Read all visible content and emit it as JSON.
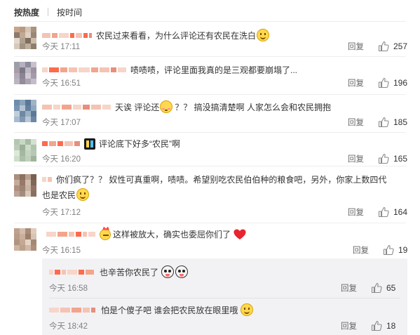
{
  "sort_tabs": {
    "hot": "按热度",
    "time": "按时间"
  },
  "reply_label": "回复",
  "colors": {
    "mosaic": [
      "#f2a58c",
      "#f5c3b3",
      "#ff6a4d",
      "#f7d5c9",
      "#e88e7a"
    ],
    "like_icon": "#8a8a8a"
  },
  "comments": [
    {
      "text": "农民过来看看，为什么评论还有农民在洗白",
      "emoji": "smile",
      "time": "今天 17:11",
      "likes": "257",
      "avatar": [
        "#c9a48a",
        "#b89a80",
        "#d8c4b2",
        "#a9927e",
        "#8d7a6a",
        "#c0a894",
        "#ddd0c4",
        "#9a8676",
        "#e4d8cc",
        "#b0a090",
        "#7f6e60",
        "#cdbcaa",
        "#d6c9bb",
        "#a39282",
        "#bfae9c",
        "#8e7d6d"
      ]
    },
    {
      "text": "啧啧啧，评论里面我真的是三观都要崩塌了...",
      "time": "今天 16:51",
      "likes": "196",
      "avatar": [
        "#9aa0a8",
        "#b6b0c0",
        "#8c8c9c",
        "#c8c0cc",
        "#a89ca8",
        "#7c7888",
        "#c0b8c4",
        "#9c94a0",
        "#b4acb8",
        "#8c8494",
        "#d0c8d4",
        "#a49cac",
        "#bcb4c0",
        "#948c98",
        "#aca4b0",
        "#c4bcc8"
      ]
    },
    {
      "text1": "天诶 评论还",
      "emoji": "shy",
      "text2": "？？ 搞没搞清楚啊 人家怎么会和农民拥抱",
      "time": "今天 17:07",
      "likes": "185",
      "avatar": [
        "#6c8caa",
        "#8aa4bc",
        "#5a7896",
        "#a0b4c8",
        "#7894ae",
        "#b4c4d4",
        "#6480a0",
        "#90a8bf",
        "#c0cedc",
        "#7088a4",
        "#9cb0c4",
        "#5c7898",
        "#a8bcd0",
        "#8098b2",
        "#b8c8d8",
        "#6c86a6"
      ]
    },
    {
      "emoji": "book",
      "text": "评论底下好多“农民”啊",
      "time": "今天 16:20",
      "likes": "165",
      "avatar": [
        "#b4c8b0",
        "#c8d8c4",
        "#a8bca4",
        "#d4e0d0",
        "#bcccb8",
        "#9cb098",
        "#ccdcc8",
        "#b0c4ac",
        "#dce8d8",
        "#a4b8a0",
        "#c4d4c0",
        "#b8c8b4",
        "#d0dccc",
        "#acc0a8",
        "#c0d0bc",
        "#a0b49c"
      ]
    },
    {
      "text": "你们疯了？？ 奴性可真重啊，啧啧。希望别吃农民伯伯种的粮食吧，另外，你家上数四代",
      "text_wrap": "也是农民",
      "emoji": "smile",
      "time": "今天 17:12",
      "likes": "164",
      "avatar": [
        "#a89080",
        "#8c7060",
        "#b8a090",
        "#786050",
        "#c4ac9c",
        "#987868",
        "#d0bcac",
        "#806858",
        "#b09080",
        "#9c8474",
        "#c8b4a4",
        "#907464",
        "#bca494",
        "#a48c7c",
        "#dcc8b8",
        "#887060"
      ]
    },
    {
      "emoji": "crown",
      "text": "这样被放大，确实也委屈你们了",
      "emoji2": "heart",
      "time": "今天 16:15",
      "likes": "19",
      "avatar": [
        "#c0a08c",
        "#d4bcac",
        "#a88c78",
        "#e0ccbc",
        "#b89c88",
        "#cab09c",
        "#9c806c",
        "#d8c4b4",
        "#b09480",
        "#c4a894",
        "#e4d4c4",
        "#a48874",
        "#ccb4a0",
        "#bca08c",
        "#d0b8a8",
        "#ac907c"
      ]
    }
  ],
  "sub_comments": [
    {
      "text": "也辛苦你农民了",
      "emoji": "dog",
      "time": "今天 16:58",
      "likes": "65"
    },
    {
      "text": "怕是个傻子吧 谁会把农民放在眼里哦",
      "emoji": "smile",
      "time": "今天 18:42",
      "likes": "18"
    }
  ]
}
